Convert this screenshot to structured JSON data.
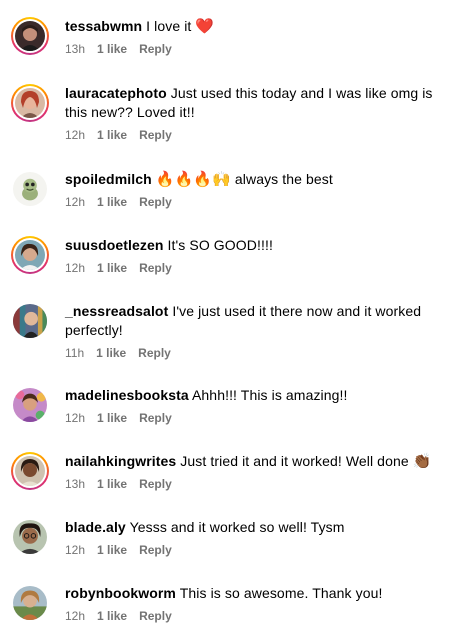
{
  "comments": [
    {
      "username": "tessabwmn",
      "text": "I love it",
      "emoji": "❤️",
      "time": "13h",
      "likes": "1 like",
      "reply": "Reply"
    },
    {
      "username": "lauracatephoto",
      "text": "Just used this today and I was like omg is this new?? Loved it!!",
      "time": "12h",
      "likes": "1 like",
      "reply": "Reply"
    },
    {
      "username": "spoiledmilch",
      "emoji": "🔥🔥🔥🙌",
      "text": "always the best",
      "time": "12h",
      "likes": "1 like",
      "reply": "Reply"
    },
    {
      "username": "suusdoetlezen",
      "text": "It's SO GOOD!!!!",
      "time": "12h",
      "likes": "1 like",
      "reply": "Reply"
    },
    {
      "username": "_nessreadsalot",
      "text": "I've just used it there now and it worked perfectly!",
      "time": "11h",
      "likes": "1 like",
      "reply": "Reply"
    },
    {
      "username": "madelinesbooksta",
      "text": "Ahhh!!! This is amazing!!",
      "time": "12h",
      "likes": "1 like",
      "reply": "Reply"
    },
    {
      "username": "nailahkingwrites",
      "text": "Just tried it and it worked! Well done",
      "emoji": "👏🏾",
      "time": "13h",
      "likes": "1 like",
      "reply": "Reply"
    },
    {
      "username": "blade.aly",
      "text": "Yesss and it worked so well! Tysm",
      "time": "12h",
      "likes": "1 like",
      "reply": "Reply"
    },
    {
      "username": "robynbookworm",
      "text": "This is so awesome. Thank you!",
      "time": "12h",
      "likes": "1 like",
      "reply": "Reply"
    }
  ],
  "colors": {
    "text": "#000000",
    "meta": "#737373",
    "story_ring": "#e1306c",
    "background": "#ffffff"
  }
}
